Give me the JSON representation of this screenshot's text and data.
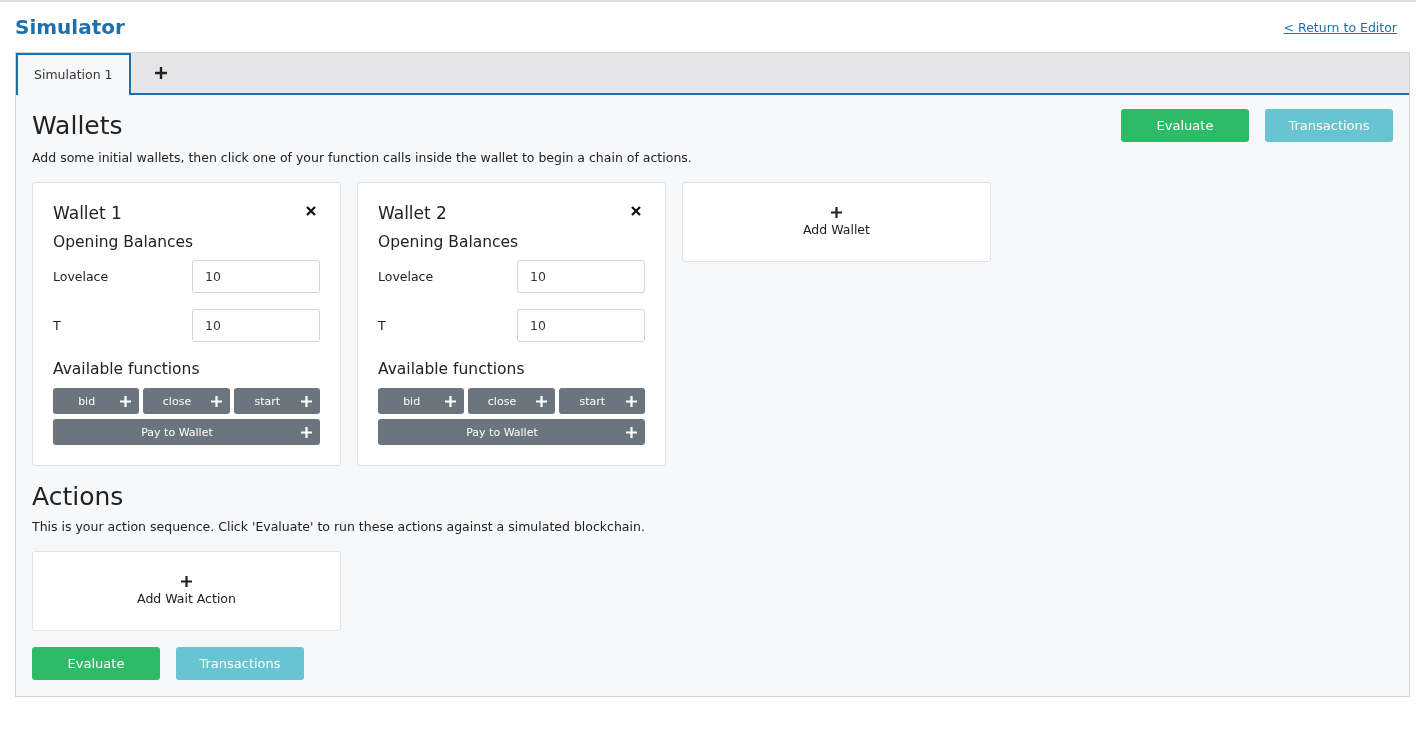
{
  "header": {
    "title": "Simulator",
    "return_link": "< Return to Editor"
  },
  "tabs": [
    {
      "label": "Simulation 1",
      "selected": true
    }
  ],
  "wallets_section": {
    "title": "Wallets",
    "description": "Add some initial wallets, then click one of your function calls inside the wallet to begin a chain of actions.",
    "buttons": [
      {
        "label": "Evaluate",
        "kind": "success"
      },
      {
        "label": "Transactions",
        "kind": "info"
      }
    ],
    "wallets": [
      {
        "title": "Wallet 1",
        "balances_title": "Opening Balances",
        "balances": [
          {
            "label": "Lovelace",
            "value": "10"
          },
          {
            "label": "T",
            "value": "10"
          }
        ],
        "functions_title": "Available functions",
        "functions": [
          "bid",
          "close",
          "start"
        ],
        "pay_function": "Pay to Wallet"
      },
      {
        "title": "Wallet 2",
        "balances_title": "Opening Balances",
        "balances": [
          {
            "label": "Lovelace",
            "value": "10"
          },
          {
            "label": "T",
            "value": "10"
          }
        ],
        "functions_title": "Available functions",
        "functions": [
          "bid",
          "close",
          "start"
        ],
        "pay_function": "Pay to Wallet"
      }
    ],
    "add_wallet": "Add Wallet"
  },
  "actions_section": {
    "title": "Actions",
    "description": "This is your action sequence. Click 'Evaluate' to run these actions against a simulated blockchain.",
    "add_action": "Add Wait Action",
    "buttons": [
      {
        "label": "Evaluate",
        "kind": "success"
      },
      {
        "label": "Transactions",
        "kind": "info"
      }
    ]
  }
}
